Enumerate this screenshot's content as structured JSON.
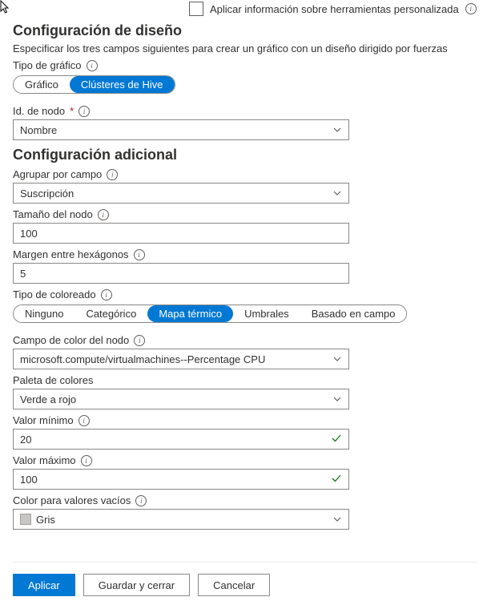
{
  "top": {
    "customTooltipLabel": "Aplicar información sobre herramientas personalizada"
  },
  "sectionDesign": "Configuración de diseño",
  "designDesc": "Especificar los tres campos siguientes para crear un gráfico con un diseño dirigido por fuerzas",
  "chartType": {
    "label": "Tipo de gráfico",
    "options": {
      "graph": "Gráfico",
      "hive": "Clústeres de Hive"
    }
  },
  "nodeId": {
    "label": "Id. de nodo",
    "value": "Nombre"
  },
  "sectionAdditional": "Configuración adicional",
  "groupBy": {
    "label": "Agrupar por campo",
    "value": "Suscripción"
  },
  "nodeSize": {
    "label": "Tamaño del nodo",
    "value": "100"
  },
  "hexMargin": {
    "label": "Margen entre hexágonos",
    "value": "5"
  },
  "coloring": {
    "label": "Tipo de coloreado",
    "options": {
      "none": "Ninguno",
      "categorical": "Categórico",
      "heatmap": "Mapa térmico",
      "thresholds": "Umbrales",
      "fieldBased": "Basado en campo"
    }
  },
  "colorField": {
    "label": "Campo de color del nodo",
    "value": "microsoft.compute/virtualmachines--Percentage CPU"
  },
  "palette": {
    "label": "Paleta de colores",
    "value": "Verde a rojo"
  },
  "minVal": {
    "label": "Valor mínimo",
    "value": "20"
  },
  "maxVal": {
    "label": "Valor máximo",
    "value": "100"
  },
  "emptyColor": {
    "label": "Color para valores vacíos",
    "value": "Gris"
  },
  "buttons": {
    "apply": "Aplicar",
    "saveClose": "Guardar y cerrar",
    "cancel": "Cancelar"
  }
}
